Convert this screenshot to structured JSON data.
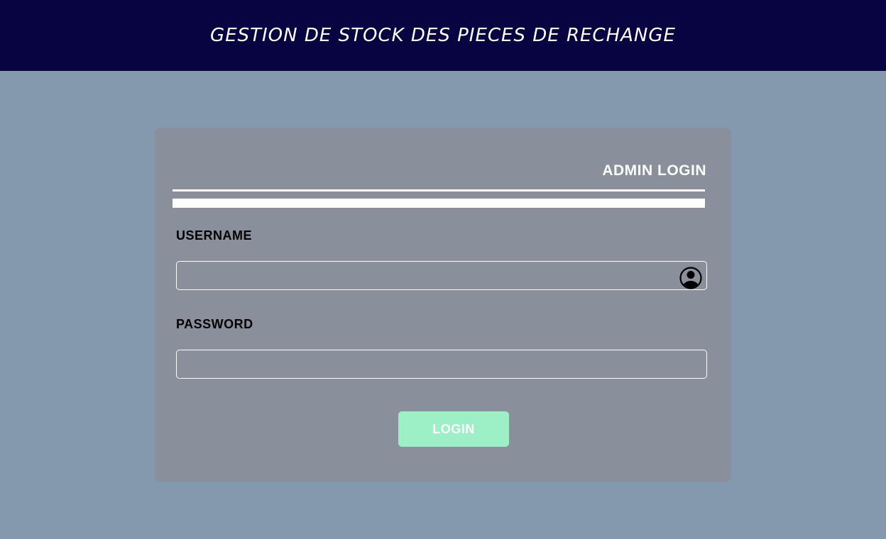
{
  "header": {
    "title": "GESTION DE STOCK DES PIECES DE RECHANGE"
  },
  "login_form": {
    "title": "ADMIN LOGIN",
    "username": {
      "label": "USERNAME",
      "value": "",
      "icon": "user-circle-icon"
    },
    "password": {
      "label": "PASSWORD",
      "value": ""
    },
    "submit_label": "LOGIN"
  },
  "colors": {
    "header_bg": "#080341",
    "page_bg": "#8499ae",
    "card_bg": "#898f9b",
    "button_bg": "#9df0c5",
    "title_text": "#ffffff",
    "label_text": "#000000"
  }
}
